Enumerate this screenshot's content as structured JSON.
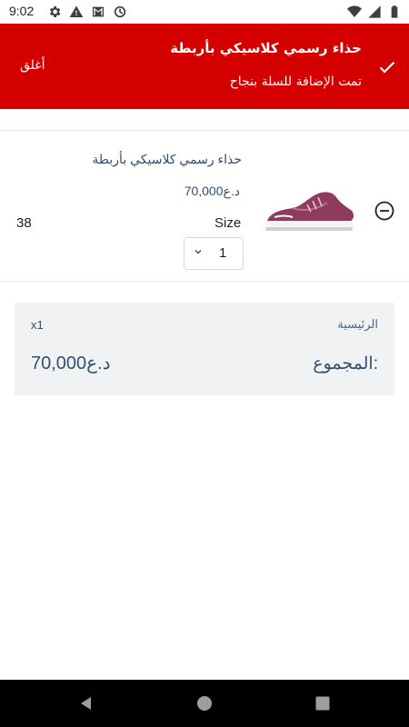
{
  "status_bar": {
    "time": "9:02",
    "left_icons": [
      "gear-icon",
      "warning-icon",
      "mail-icon",
      "sync-icon"
    ],
    "right_icons": [
      "wifi-icon",
      "signal-icon",
      "battery-icon"
    ]
  },
  "toast": {
    "title": "حذاء رسمي كلاسيكي بأربطة",
    "message": "تمت الإضافة للسلة بنجاح",
    "close_label": "أغلق",
    "background": "#d40000"
  },
  "cart_item": {
    "name": "حذاء رسمي كلاسيكي بأربطة",
    "price": "70,000د.ع",
    "size_label": "Size",
    "size_value": "38",
    "quantity": "1"
  },
  "summary": {
    "store_name": "الرئيسية",
    "item_count": "x1",
    "total_label": "المجموع:",
    "total_value": "70,000د.ع"
  },
  "nav_bar": {
    "icons": [
      "back-icon",
      "home-icon",
      "recents-icon"
    ]
  }
}
